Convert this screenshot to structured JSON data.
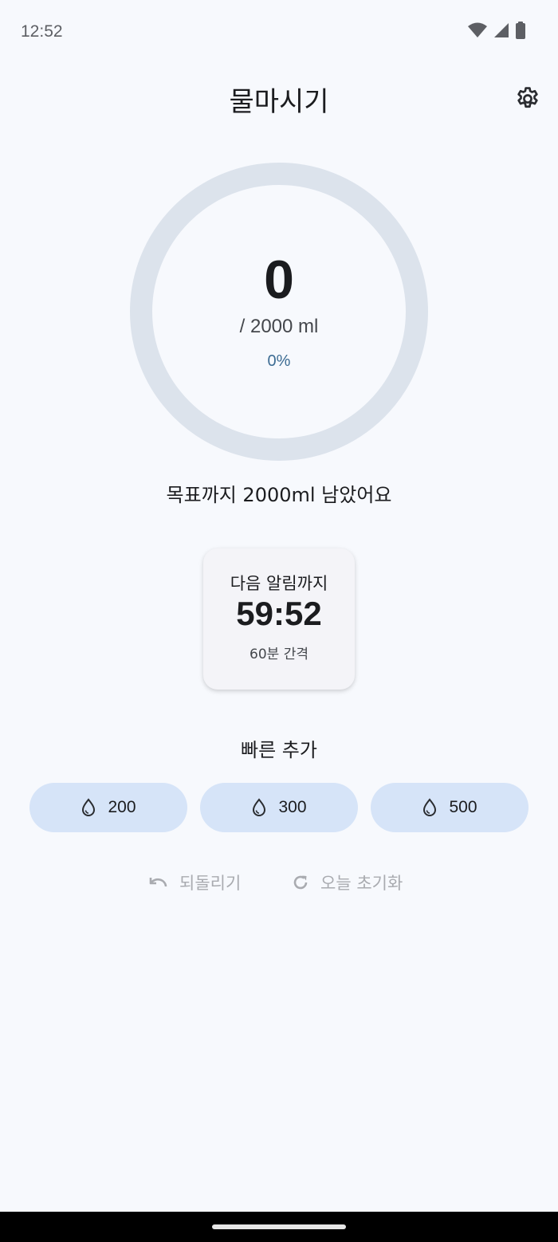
{
  "status_bar": {
    "time": "12:52",
    "icons": [
      "wifi-icon",
      "signal-icon",
      "battery-icon"
    ]
  },
  "header": {
    "title": "물마시기",
    "settings_icon": "gear-icon"
  },
  "progress": {
    "current": "0",
    "goal_label": "/ 2000 ml",
    "percent_label": "0%",
    "fraction": 0,
    "ring_color": "#dce3ec",
    "fill_color": "#3c6c93"
  },
  "remaining_message": "목표까지 2000ml 남았어요",
  "timer": {
    "label": "다음 알림까지",
    "value": "59:52",
    "interval": "60분 간격"
  },
  "quick_add": {
    "title": "빠른 추가",
    "icon": "water-drop-icon",
    "buttons": [
      {
        "label": "200"
      },
      {
        "label": "300"
      },
      {
        "label": "500"
      }
    ]
  },
  "actions": {
    "undo_label": "되돌리기",
    "undo_icon": "undo-icon",
    "reset_label": "오늘 초기화",
    "reset_icon": "refresh-icon"
  },
  "colors": {
    "background": "#f7f9fd",
    "quick_button": "#d6e4f8",
    "muted_text": "#a9abb0"
  }
}
